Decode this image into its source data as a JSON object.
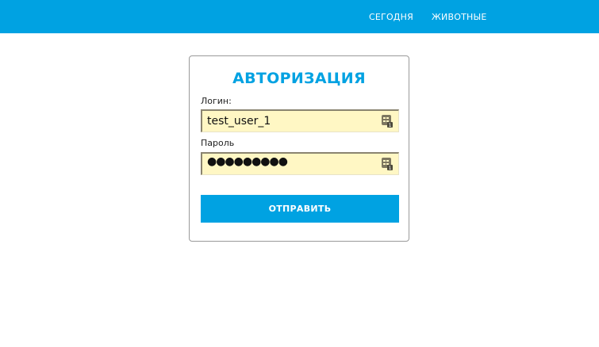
{
  "nav": {
    "items": [
      {
        "label": "СЕГОДНЯ"
      },
      {
        "label": "ЖИВОТНЫЕ"
      }
    ]
  },
  "login_form": {
    "title": "АВТОРИЗАЦИЯ",
    "login_label": "Логин:",
    "login_value": "test_user_1",
    "password_label": "Пароль",
    "password_masked": "●●●●●●●●●",
    "submit_label": "ОТПРАВИТЬ"
  },
  "icons": {
    "autofill": "password-manager-autofill-icon"
  },
  "colors": {
    "accent": "#00a2e2",
    "input_background": "#fff7c4",
    "card_border": "#9a9a9a"
  }
}
